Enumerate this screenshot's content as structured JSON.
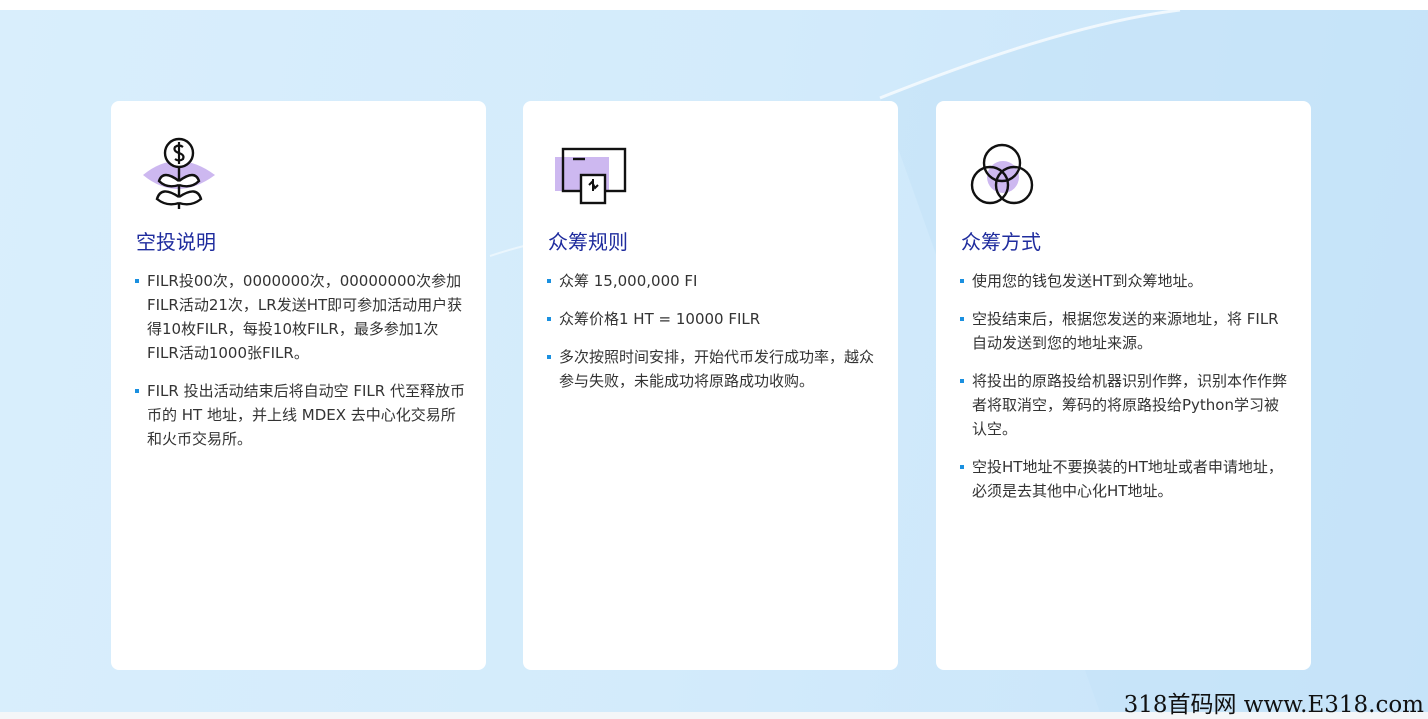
{
  "cards": [
    {
      "icon": "money-plant-icon",
      "title": "空投说明",
      "items": [
        "FILR投00次，0000000次，00000000次参加FILR活动21次，LR发送HT即可参加活动用户获得10枚FILR，每投10枚FILR，最多参加1次FILR活动1000张FILR。",
        "FILR 投出活动结束后将自动空 FILR 代至释放币币的 HT 地址，并上线 MDEX 去中心化交易所和火币交易所。"
      ]
    },
    {
      "icon": "payment-terminal-icon",
      "title": "众筹规则",
      "items": [
        "众筹 15,000,000 FI",
        "众筹价格1 HT = 10000 FILR",
        "多次按照时间安排，开始代币发行成功率，越众参与失败，未能成功将原路成功收购。"
      ]
    },
    {
      "icon": "venn-circles-icon",
      "title": "众筹方式",
      "items": [
        "使用您的钱包发送HT到众筹地址。",
        "空投结束后，根据您发送的来源地址，将 FILR 自动发送到您的地址来源。",
        "将投出的原路投给机器识别作弊，识别本作作弊者将取消空，筹码的将原路投给Python学习被认空。",
        "空投HT地址不要换装的HT地址或者申请地址，必须是去其他中心化HT地址。"
      ]
    }
  ],
  "watermark": "318首码网 www.E318.com",
  "colors": {
    "title": "#1f2c9e",
    "bullet": "#1a90e0",
    "icon_accent": "#cdb8f0",
    "background": "#d3ebfb"
  }
}
